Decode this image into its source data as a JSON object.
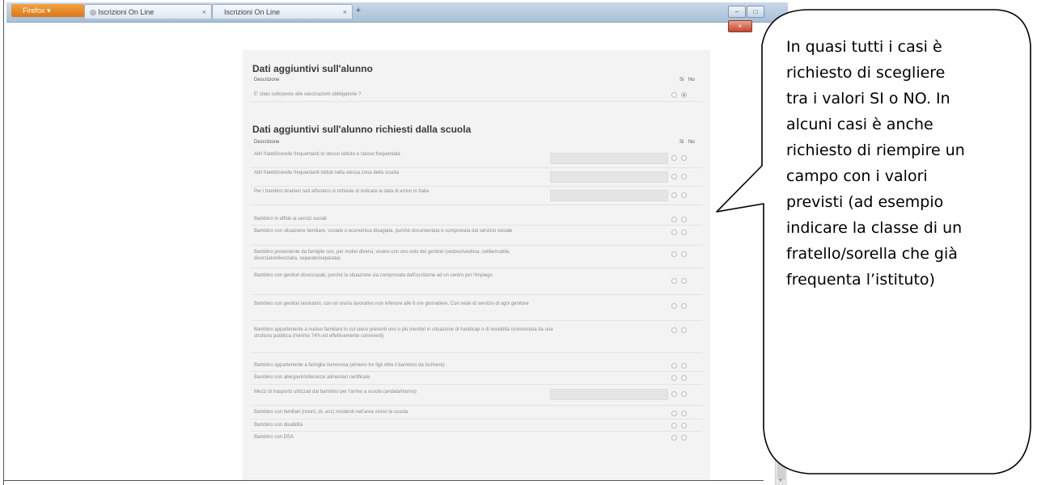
{
  "browser": {
    "firefox_label": "Firefox",
    "tab1_title": "Iscrizioni On Line",
    "tab2_title": "Iscrizioni On Line",
    "new_tab": "+",
    "tab_close": "×",
    "min": "–",
    "max": "□",
    "close": "×"
  },
  "section1": {
    "title": "Dati aggiuntivi sull'alunno",
    "col_description": "Descrizione",
    "col_si": "Si",
    "col_no": "No",
    "rows": [
      {
        "label": "E' stato sottoposto alle vaccinazioni obbligatorie ?",
        "selected": "No"
      }
    ]
  },
  "section2": {
    "title": "Dati aggiuntivi sull'alunno richiesti dalla scuola",
    "col_description": "Descrizione",
    "col_si": "Si",
    "col_no": "No",
    "rows": [
      {
        "label": "Altri fratelli/sorelle frequentanti lo stesso istituto e classe frequentata",
        "has_field": true
      },
      {
        "label": "Altri fratelli/sorelle frequentanti istituti nella stessa zona della scuola",
        "has_field": true
      },
      {
        "label": "Per i bambini stranieri nati all'estero si richiede di indicare la data di arrivo in Italia",
        "has_field": true
      },
      {
        "label": "Bambino in affido ai servizi sociali",
        "has_field": false
      },
      {
        "label": "Bambino con situazione familiare, sociale o economica disagiata, purché documentata e comprovata dal servizio sociale",
        "has_field": false
      },
      {
        "label": "Bambino proveniente da famiglie con, per motivi diversi, vivano con uno solo dei genitori (vedovo/vedova, celibe/nubile, divorziato/divorziata, separato/separata)",
        "has_field": false
      },
      {
        "label": "Bambino con genitori disoccupati, purché la situazione sia comprovata dall'iscrizione ad un centro per l'impiego",
        "has_field": false
      },
      {
        "label": "Bambino con genitori lavoratori, con un orario lavorativo non inferiore alle 6 ore giornaliere. Con sede di servizio di ogni genitore",
        "has_field": false
      },
      {
        "label": "Bambino appartenente a nucleo familiare in cui siano presenti uno o più membri in situazione di handicap o di invalidità riconosciuta da una struttura pubblica (minimo 74% ed effettivamente conviventi)",
        "has_field": false
      },
      {
        "label": "Bambino appartenente a famiglia numerosa (almeno tre figli oltre il bambino da iscrivere)",
        "has_field": false
      },
      {
        "label": "Bambino con allergie/intolleranze alimentari certificate",
        "has_field": false
      },
      {
        "label": "Mezzi di trasporto utilizzati dal bambino per l'arrivo a scuola (andata/ritorno)",
        "has_field": true
      },
      {
        "label": "Bambino con familiari (nonni, zii, ecc) residenti nell'area vicino la scuola",
        "has_field": false
      },
      {
        "label": "Bambino con disabilità",
        "has_field": false
      },
      {
        "label": "Bambino con DSA",
        "has_field": false
      }
    ]
  },
  "callout": {
    "lines": [
      "In quasi tutti i casi è",
      "richiesto di scegliere",
      "tra i valori SI o NO. In",
      "alcuni casi è anche",
      "richiesto di riempire un",
      "campo con i valori",
      "previsti  (ad esempio",
      "indicare la classe di un",
      "fratello/sorella che già",
      "frequenta l’istituto)"
    ]
  }
}
